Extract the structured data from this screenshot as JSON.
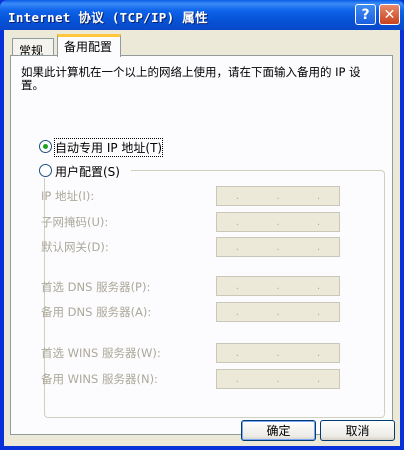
{
  "window": {
    "title": "Internet 协议 (TCP/IP) 属性",
    "help_label": "?",
    "close_label": "✕"
  },
  "tabs": [
    {
      "label": "常规"
    },
    {
      "label": "备用配置"
    }
  ],
  "description": "如果此计算机在一个以上的网络上使用，请在下面输入备用的 IP 设置。",
  "options": {
    "auto": {
      "label": "自动专用 IP 地址(T)",
      "selected": true
    },
    "user": {
      "label": "用户配置(S)",
      "selected": false
    }
  },
  "fields": [
    {
      "label": "IP 地址(I):"
    },
    {
      "label": "子网掩码(U):"
    },
    {
      "label": "默认网关(D):"
    },
    {
      "label": "首选 DNS 服务器(P):"
    },
    {
      "label": "备用 DNS 服务器(A):"
    },
    {
      "label": "首选 WINS 服务器(W):"
    },
    {
      "label": "备用 WINS 服务器(N):"
    }
  ],
  "buttons": {
    "ok": "确定",
    "cancel": "取消"
  },
  "colors": {
    "title_bar": "#0a5be8",
    "dialog_bg": "#ece9d8",
    "disabled_text": "#aca899",
    "radio_dot": "#21a121"
  }
}
